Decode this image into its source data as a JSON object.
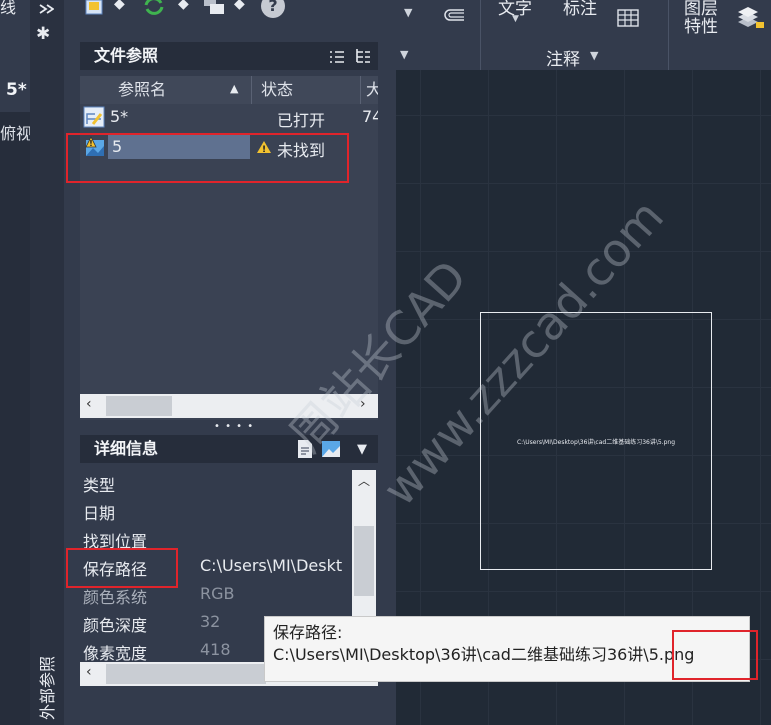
{
  "ribbon": {
    "text_label": "文字",
    "dim_label": "标注",
    "annotation_label": "注释",
    "layer_props_line1": "图层",
    "layer_props_line2": "特性",
    "partial_left": "线"
  },
  "doc_tab": {
    "label": "5*",
    "view_label": "俯视"
  },
  "vertical_title": "外部参照",
  "file_refs": {
    "title": "文件参照",
    "columns": {
      "name": "参照名",
      "status": "状态",
      "size_partial": "大"
    },
    "rows": [
      {
        "name": "5*",
        "status": "已打开",
        "size": "74"
      },
      {
        "name": "5",
        "status": "未找到",
        "size": ""
      }
    ]
  },
  "details": {
    "title": "详细信息",
    "rows": [
      {
        "label": "类型",
        "value": ""
      },
      {
        "label": "日期",
        "value": ""
      },
      {
        "label": "找到位置",
        "value": ""
      },
      {
        "label": "保存路径",
        "value": "C:\\Users\\MI\\Deskt"
      },
      {
        "label": "颜色系统",
        "value": "RGB"
      },
      {
        "label": "颜色深度",
        "value": "32"
      },
      {
        "label": "像素宽度",
        "value": "418"
      }
    ]
  },
  "tooltip": {
    "line1": "保存路径:",
    "line2": "C:\\Users\\MI\\Desktop\\36讲\\cad二维基础练习36讲\\5.png"
  },
  "canvas_image_label": "C:\\Users\\MI\\Desktop\\36讲\\cad二维基础练习36讲\\5.png",
  "watermark": {
    "line1": "周站长CAD",
    "line2": "www.zzzcad.com"
  },
  "colors": {
    "accent_red": "#e0242b",
    "selection": "#5f7190",
    "warning": "#f2c230"
  }
}
